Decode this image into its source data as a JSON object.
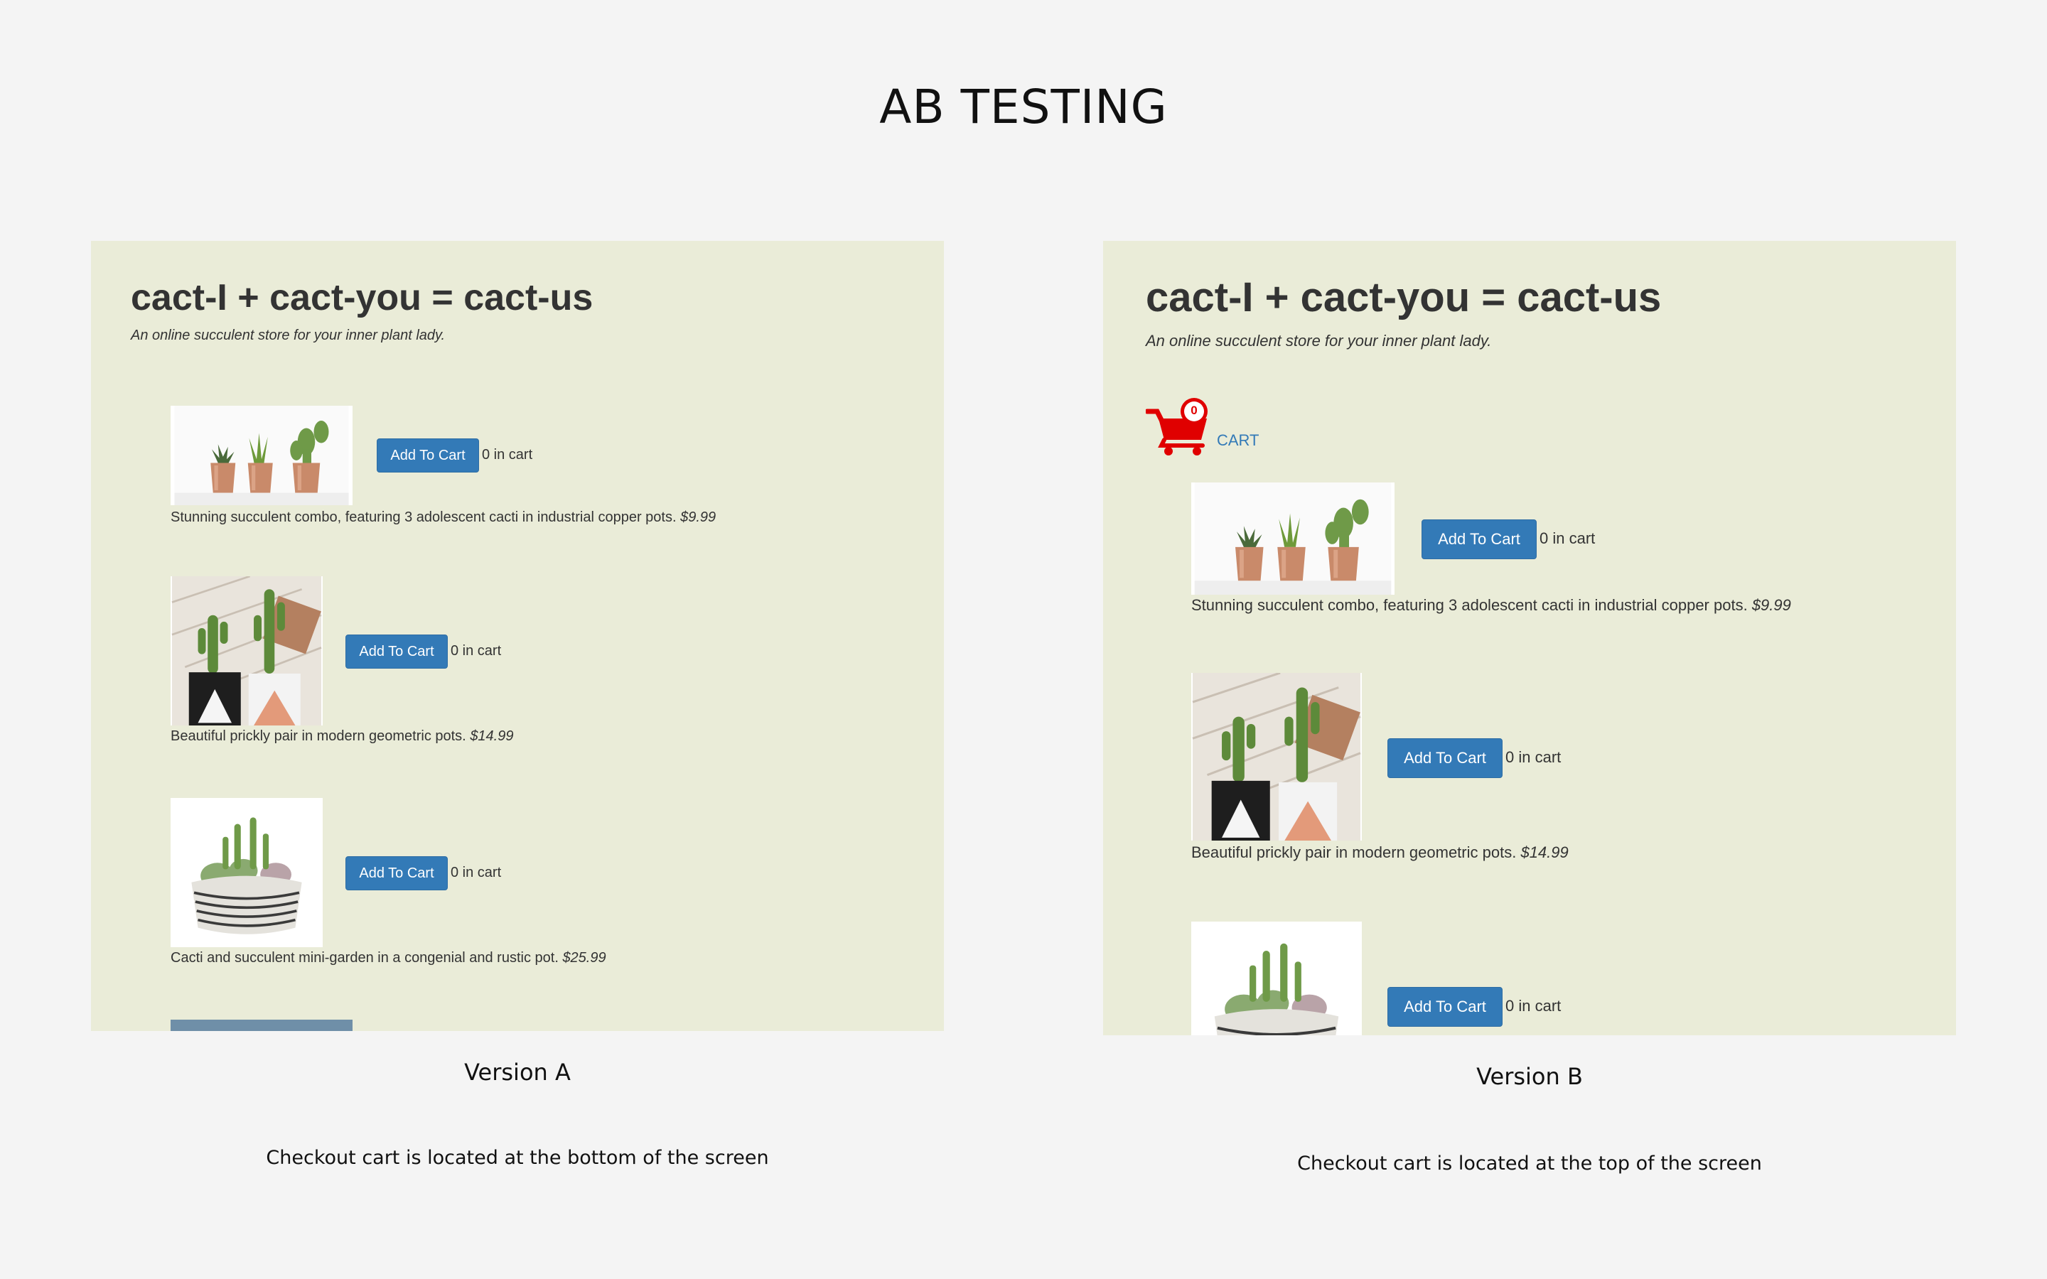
{
  "page": {
    "title": "AB TESTING"
  },
  "store": {
    "name": "cact-I + cact-you = cact-us",
    "tagline": "An online succulent store for your inner plant lady."
  },
  "products": [
    {
      "image": "three-cacti-copper-pots",
      "button": "Add To Cart",
      "count": "0 in cart",
      "description": "Stunning succulent combo, featuring 3 adolescent cacti in industrial copper pots.",
      "price": "$9.99"
    },
    {
      "image": "geometric-pots-pair",
      "button": "Add To Cart",
      "count": "0 in cart",
      "description": "Beautiful prickly pair in modern geometric pots.",
      "price": "$14.99"
    },
    {
      "image": "mini-garden-bowl",
      "button": "Add To Cart",
      "count": "0 in cart",
      "description": "Cacti and succulent mini-garden in a congenial and rustic pot.",
      "price": "$25.99"
    }
  ],
  "cart": {
    "label": "CART",
    "badge": "0",
    "icon": "shopping-cart-icon",
    "color": "#e00000"
  },
  "colors": {
    "page_bg": "#f4f4f4",
    "panel_bg": "#eaecd8",
    "button": "#337ab7"
  },
  "version_a": {
    "label": "Version A",
    "note": "Checkout cart is located at the bottom of the screen"
  },
  "version_b": {
    "label": "Version B",
    "note": "Checkout cart is located at the top of the screen"
  }
}
